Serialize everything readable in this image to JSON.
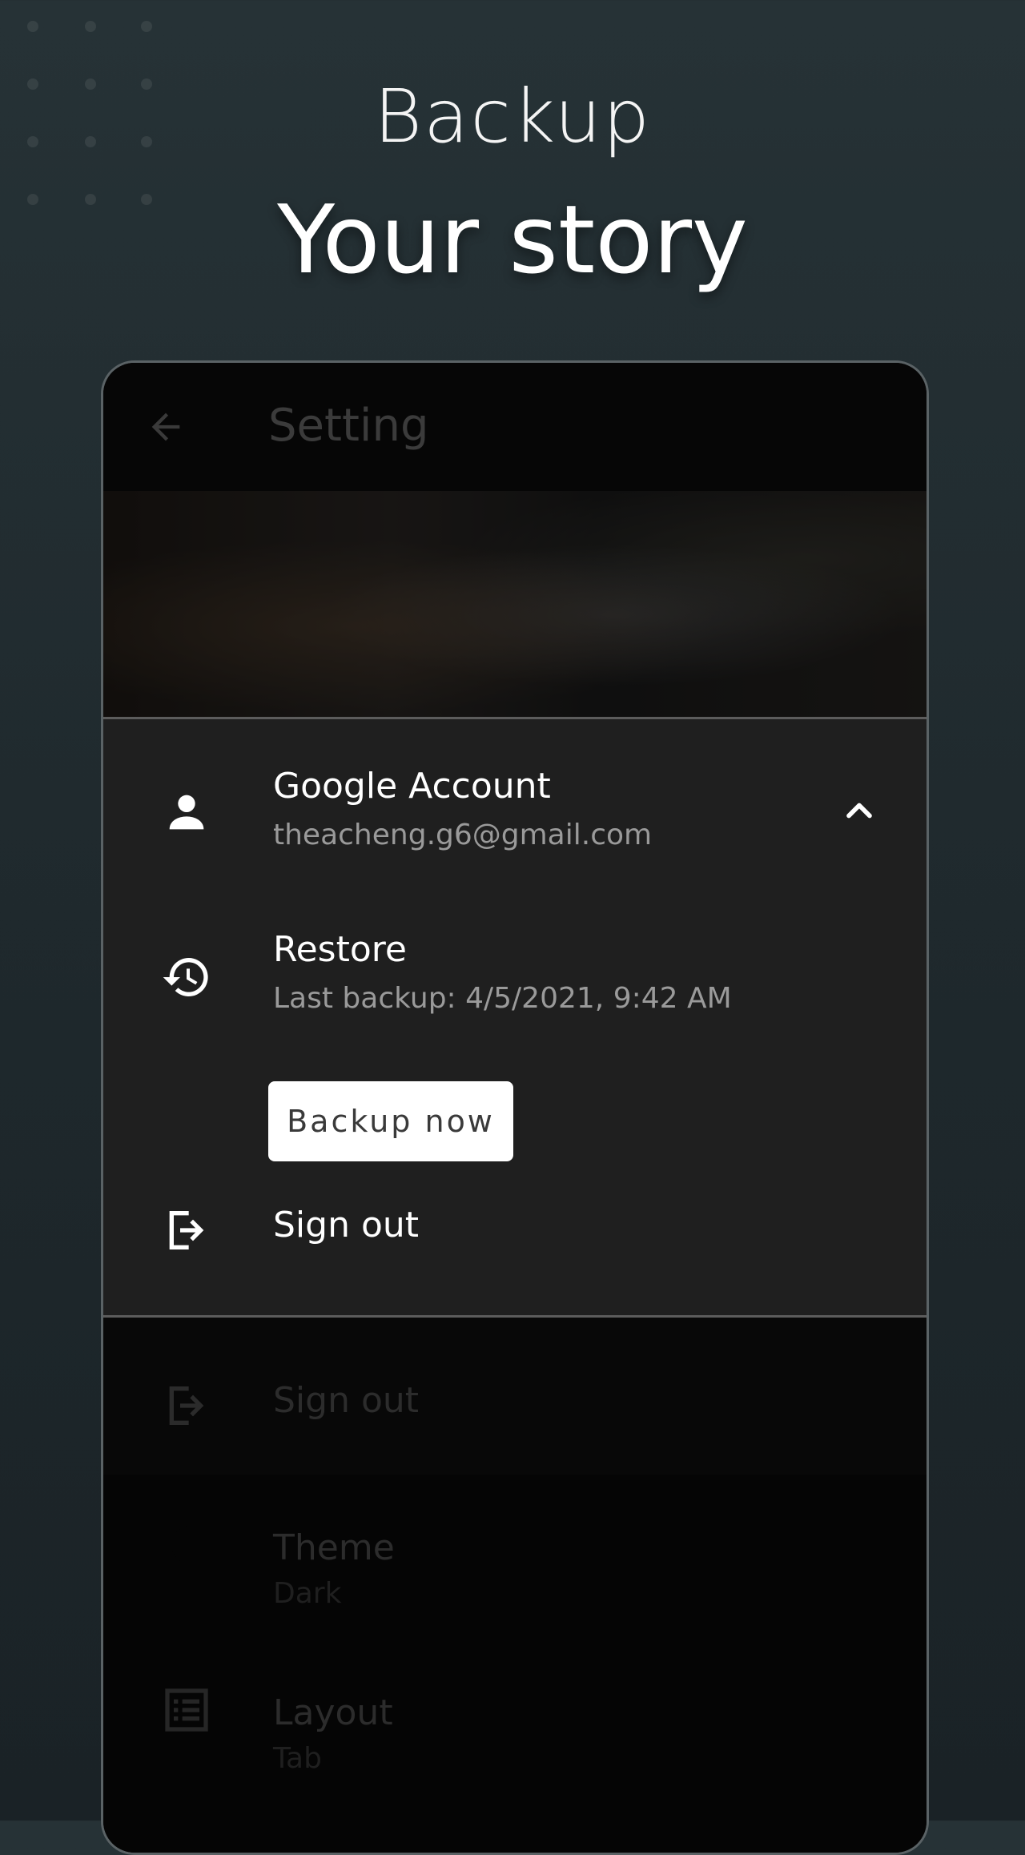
{
  "hero": {
    "subtitle": "Backup",
    "title": "Your story"
  },
  "appbar": {
    "title": "Setting",
    "back_icon": "arrow-left-icon"
  },
  "account_sheet": {
    "google_account": {
      "title": "Google Account",
      "email": "theacheng.g6@gmail.com",
      "icon": "person-icon",
      "expand_icon": "chevron-up-icon"
    },
    "restore": {
      "title": "Restore",
      "last_backup": "Last backup: 4/5/2021, 9:42 AM",
      "icon": "history-icon"
    },
    "backup_button": "Backup now",
    "sign_out": {
      "title": "Sign out",
      "icon": "logout-icon"
    }
  },
  "background_list": {
    "sign_out": "Sign out",
    "theme": {
      "title": "Theme",
      "value": "Dark"
    },
    "layout": {
      "title": "Layout",
      "value": "Tab"
    }
  },
  "colors": {
    "page_bg": "#263236",
    "sheet_bg": "#1f1f1f",
    "button_bg": "#ffffff"
  }
}
